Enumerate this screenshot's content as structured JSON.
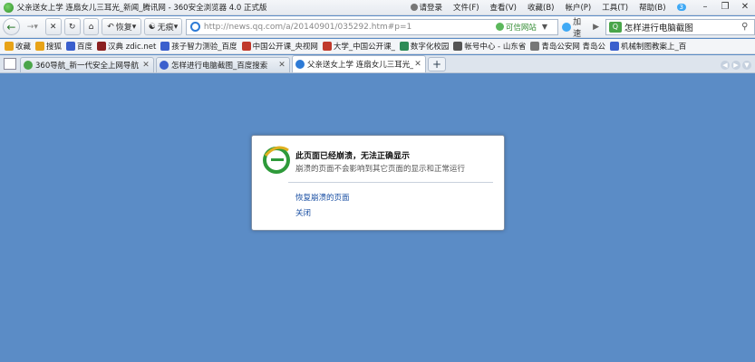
{
  "window": {
    "title": "父亲送女上学 连扇女儿三耳光_新闻_腾讯网 - 360安全浏览器 4.0 正式版",
    "menus": [
      "请登录",
      "文件(F)",
      "查看(V)",
      "收藏(B)",
      "帐户(P)",
      "工具(T)",
      "帮助(B)"
    ],
    "badge": "3"
  },
  "nav": {
    "restore_label": "恢复",
    "ads_label": "无痕",
    "url": "http://news.qq.com/a/20140901/035292.htm#p=1",
    "trusted_label": "可信网站",
    "speed_label": "加速",
    "search_text": "怎样进行电脑截图"
  },
  "favorites": [
    {
      "label": "收藏",
      "icon": "star-icon",
      "color": "#e8a317"
    },
    {
      "label": "搜狐",
      "icon": "sohu-icon",
      "color": "#e8a317"
    },
    {
      "label": "百度",
      "icon": "baidu-icon",
      "color": "#3a5fcd"
    },
    {
      "label": "汉典 zdic.net",
      "icon": "zdic-icon",
      "color": "#8b2020"
    },
    {
      "label": "孩子智力测验_百度",
      "icon": "baidu-icon",
      "color": "#3a5fcd"
    },
    {
      "label": "中国公开课_央视网",
      "icon": "cctv-icon",
      "color": "#c0392b"
    },
    {
      "label": "大学_中国公开课_",
      "icon": "cctv-icon",
      "color": "#c0392b"
    },
    {
      "label": "数字化校园",
      "icon": "campus-icon",
      "color": "#2e8b57"
    },
    {
      "label": "帐号中心 - 山东省",
      "icon": "account-icon",
      "color": "#555"
    },
    {
      "label": "青岛公安网 青岛公",
      "icon": "police-icon",
      "color": "#777"
    },
    {
      "label": "机械制图教案上_百",
      "icon": "baidu-icon",
      "color": "#3a5fcd"
    }
  ],
  "tabs": [
    {
      "label": "360导航_新一代安全上网导航",
      "icon_color": "#4aa54a",
      "active": false
    },
    {
      "label": "怎样进行电脑截图_百度搜索",
      "icon_color": "#3a5fcd",
      "active": false
    },
    {
      "label": "父亲送女上学 连扇女儿三耳光_",
      "icon_color": "#2e7bd6",
      "active": true
    }
  ],
  "dialog": {
    "title": "此页面已经崩溃，无法正确显示",
    "description": "崩溃的页面不会影响到其它页面的显示和正常运行",
    "restore_link": "恢复崩溃的页面",
    "close_link": "关闭"
  },
  "colors": {
    "background": "#5b8cc6",
    "link": "#1a4fa3",
    "ie_blue": "#2e7bd6",
    "ie_green": "#3ca43c"
  }
}
